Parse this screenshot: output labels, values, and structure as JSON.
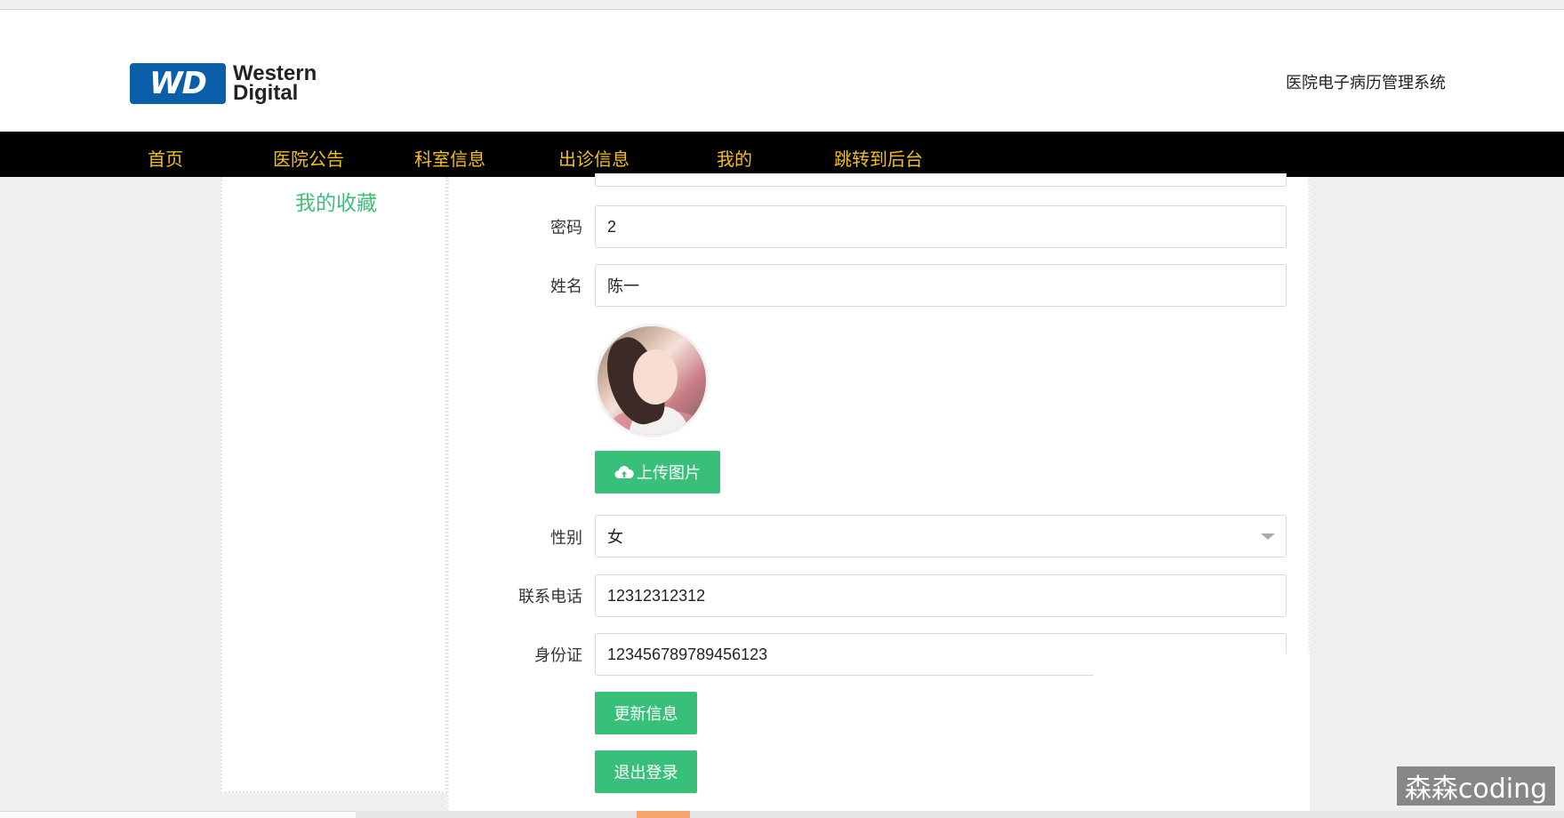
{
  "header": {
    "logo": {
      "line1": "Western",
      "line2": "Digital",
      "badge": "WD"
    },
    "system_title": "医院电子病历管理系统"
  },
  "nav": {
    "items": [
      {
        "label": "首页"
      },
      {
        "label": "医院公告"
      },
      {
        "label": "科室信息"
      },
      {
        "label": "出诊信息"
      },
      {
        "label": "我的"
      },
      {
        "label": "跳转到后台"
      }
    ]
  },
  "sidebar": {
    "favorites_label": "我的收藏"
  },
  "form": {
    "password": {
      "label": "密码",
      "value": "2"
    },
    "name": {
      "label": "姓名",
      "value": "陈一"
    },
    "upload_button": "上传图片",
    "gender": {
      "label": "性别",
      "value": "女"
    },
    "phone": {
      "label": "联系电话",
      "value": "12312312312"
    },
    "id_card": {
      "label": "身份证",
      "value": "123456789789456123"
    },
    "update_button": "更新信息",
    "logout_button": "退出登录"
  },
  "watermark": "森森coding",
  "colors": {
    "nav_bg": "#000000",
    "nav_text": "#f3c012",
    "accent_green": "#38c07a",
    "link_green": "#3fbf7a"
  }
}
